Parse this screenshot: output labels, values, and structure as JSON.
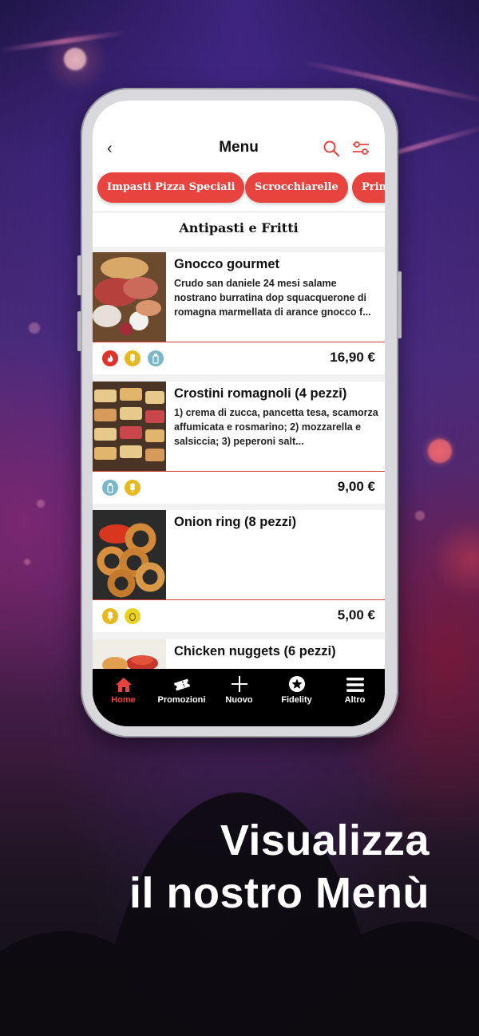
{
  "header": {
    "title": "Menu"
  },
  "categories": [
    "Impasti Pizza Speciali",
    "Scrocchiarelle",
    "Prim"
  ],
  "section_title": "Antipasti e Fritti",
  "items": [
    {
      "name": "Gnocco gourmet",
      "description": "Crudo san daniele 24 mesi salame nostrano burratina dop squacquerone di romagna marmellata di arance gnocco f...",
      "price": "16,90 €",
      "badges": [
        "spicy-icon",
        "gluten-icon",
        "milk-icon"
      ]
    },
    {
      "name": "Crostini romagnoli (4 pezzi)",
      "description": "1) crema di zucca, pancetta tesa, scamorza affumicata e rosmarino; 2) mozzarella e salsiccia; 3) peperoni salt...",
      "price": "9,00 €",
      "badges": [
        "milk-icon",
        "gluten-icon"
      ]
    },
    {
      "name": "Onion ring (8 pezzi)",
      "description": "",
      "price": "5,00 €",
      "badges": [
        "gluten-icon",
        "egg-icon"
      ]
    },
    {
      "name": "Chicken nuggets (6 pezzi)",
      "description": "",
      "price": "",
      "badges": []
    }
  ],
  "tabbar": {
    "items": [
      {
        "label": "Home",
        "icon": "home-icon",
        "active": true
      },
      {
        "label": "Promozioni",
        "icon": "ticket-icon",
        "active": false
      },
      {
        "label": "Nuovo",
        "icon": "plus-icon",
        "active": false
      },
      {
        "label": "Fidelity",
        "icon": "star-icon",
        "active": false
      },
      {
        "label": "Altro",
        "icon": "menu-icon",
        "active": false
      }
    ]
  },
  "caption": {
    "line1": "Visualizza",
    "line2": "il nostro Menù"
  },
  "colors": {
    "accent": "#e8433f",
    "tabbar_bg": "#000000",
    "badge_red": "#e0302a",
    "badge_yellow": "#e8b820",
    "badge_blue": "#7ab8c9"
  }
}
